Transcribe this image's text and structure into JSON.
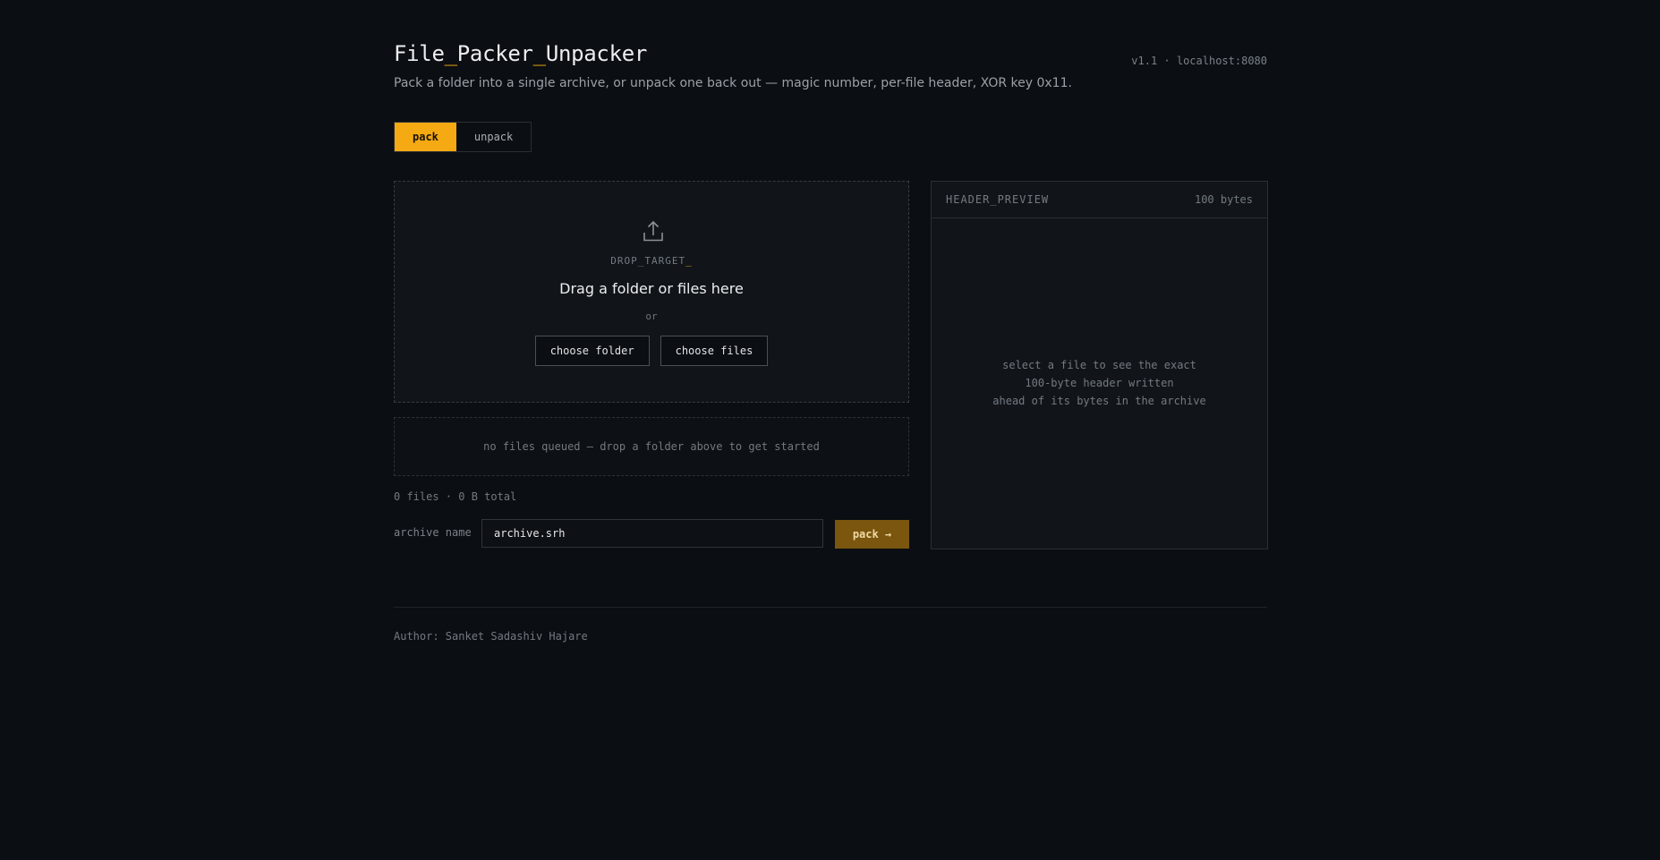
{
  "header": {
    "title_parts": [
      "File",
      "_",
      "Packer",
      "_",
      "Unpacker"
    ],
    "subtitle": "Pack a folder into a single archive, or unpack one back out — magic number, per-file header, XOR key 0x11.",
    "version": "v1.1 · localhost:8080"
  },
  "tabs": [
    {
      "label": "pack",
      "active": true
    },
    {
      "label": "unpack",
      "active": false
    }
  ],
  "drop_zone": {
    "icon": "upload-icon",
    "tag": "DROP_TARGET",
    "tag_cursor": "_",
    "heading": "Drag a folder or files here",
    "or_text": "or",
    "choose_folder_label": "choose folder",
    "choose_files_label": "choose files"
  },
  "queue": {
    "empty_message": "no files queued — drop a folder above to get started"
  },
  "totals": "0 files · 0 B total",
  "archive": {
    "label": "archive name",
    "value": "archive.srh",
    "pack_label": "pack →"
  },
  "preview": {
    "title": "HEADER_PREVIEW",
    "size": "100 bytes",
    "hint_lines": [
      "select a file to see the exact",
      "100-byte header written",
      "ahead of its bytes in the archive"
    ]
  },
  "footer": {
    "author": "Author: Sanket Sadashiv Hajare"
  },
  "colors": {
    "background": "#0b0e12",
    "panel": "#111519",
    "accent": "#f5a912",
    "pack_button": "#7a560e"
  }
}
